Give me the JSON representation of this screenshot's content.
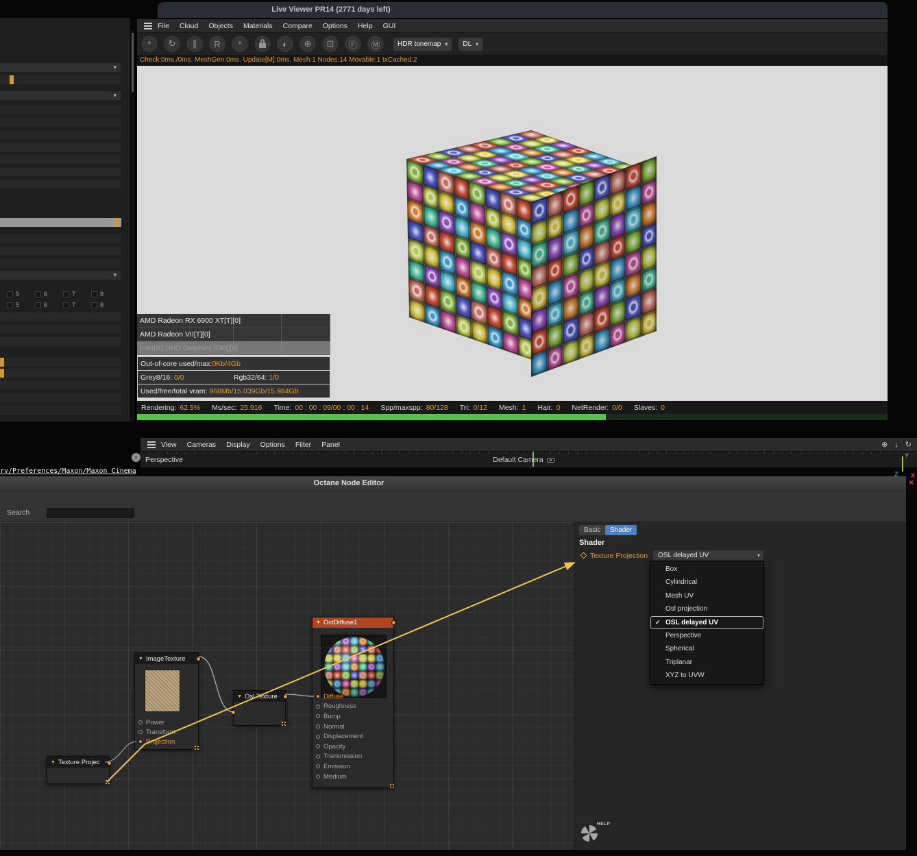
{
  "live_viewer": {
    "title": "Live Viewer PR14 (2771 days left)",
    "menu": [
      "File",
      "Cloud",
      "Objects",
      "Materials",
      "Compare",
      "Options",
      "Help",
      "GUI"
    ],
    "toolbar": {
      "icons": [
        {
          "name": "denoise-icon",
          "glyph": "*"
        },
        {
          "name": "restart-render-icon",
          "glyph": "↻"
        },
        {
          "name": "pause-render-icon",
          "glyph": "∥"
        },
        {
          "name": "region-render-icon",
          "glyph": "R"
        },
        {
          "name": "render-settings-icon",
          "glyph": "*"
        },
        {
          "name": "lock-resolution-icon",
          "glyph": ""
        },
        {
          "name": "clay-mode-icon",
          "glyph": "◐"
        },
        {
          "name": "render-region-add-icon",
          "glyph": "⊕"
        },
        {
          "name": "picking-mode-icon",
          "glyph": "⊡"
        },
        {
          "name": "focus-picker-icon",
          "glyph": "Ⓕ"
        },
        {
          "name": "material-picker-icon",
          "glyph": "Ⓜ"
        }
      ],
      "tonemap_dropdown": "HDR tonemap",
      "device_dropdown": "DL"
    },
    "stats_line": "Check:0ms./0ms. MeshGen:0ms. Update[M]:0ms. Mesh:1 Nodes:14 Movable:1 txCached:2",
    "gpu_table": {
      "rows": [
        {
          "name": "AMD Radeon RX 6900 XT[T][0]"
        },
        {
          "name": "AMD Radeon VII[T][0]"
        },
        {
          "name": "Intel(R) UHD Graphics 630[][0]"
        }
      ],
      "out_of_core_label": "Out-of-core used/max:",
      "out_of_core_value": "0Kb/4Gb",
      "grey_label": "Grey8/16:",
      "grey_value": "0/0",
      "rgb_label": "Rgb32/64:",
      "rgb_value": "1/0",
      "vram_label": "Used/free/total vram:",
      "vram_value": "968Mb/15.039Gb/15.984Gb"
    },
    "render_status": [
      {
        "label": "Rendering:",
        "value": "62.5%"
      },
      {
        "label": "Ms/sec:",
        "value": "25.916"
      },
      {
        "label": "Time:",
        "value": "00 : 00 : 09/00 : 00 : 14"
      },
      {
        "label": "Spp/maxspp:",
        "value": "80/128"
      },
      {
        "label": "Tri:",
        "value": "0/12"
      },
      {
        "label": "Mesh:",
        "value": "1"
      },
      {
        "label": "Hair:",
        "value": "0"
      },
      {
        "label": "NetRender:",
        "value": "0/0"
      },
      {
        "label": "Slaves:",
        "value": "0"
      }
    ],
    "progress_percent": 62.5
  },
  "left_panel": {
    "checkbox_rows": [
      [
        "5",
        "6",
        "7",
        "8"
      ],
      [
        "5",
        "6",
        "7",
        "8"
      ]
    ]
  },
  "c4d_viewport": {
    "menu": [
      "View",
      "Cameras",
      "Display",
      "Options",
      "Filter",
      "Panel"
    ],
    "right_icons": [
      {
        "name": "pan-view-icon",
        "glyph": "⊕"
      },
      {
        "name": "minimize-view-icon",
        "glyph": "↓"
      },
      {
        "name": "rotate-view-icon",
        "glyph": "↻"
      }
    ],
    "close_glyph": "×",
    "view_label": "Perspective",
    "camera_label": "Default Camera",
    "path_text": "rv/Preferences/Maxon/Maxon Cinema",
    "axis": {
      "x": "X",
      "y": "Y",
      "z": "Z"
    }
  },
  "node_editor": {
    "title": "Octane Node Editor",
    "close_glyph": "×",
    "search_label": "Search",
    "search_value": "",
    "tabs": [
      {
        "label": "Basic",
        "active": false
      },
      {
        "label": "Shader",
        "active": true
      }
    ],
    "section_title": "Shader",
    "param": {
      "label": "Texture Projection",
      "value": "OSL delayed UV"
    },
    "dropdown_options": [
      {
        "label": "Box",
        "selected": false
      },
      {
        "label": "Cylindrical",
        "selected": false
      },
      {
        "label": "Mesh UV",
        "selected": false
      },
      {
        "label": "Osl projection",
        "selected": false
      },
      {
        "label": "OSL delayed UV",
        "selected": true
      },
      {
        "label": "Perspective",
        "selected": false
      },
      {
        "label": "Spherical",
        "selected": false
      },
      {
        "label": "Triplanar",
        "selected": false
      },
      {
        "label": "XYZ to UVW",
        "selected": false
      }
    ],
    "help_label": "HELP",
    "nodes": {
      "texture_projection": {
        "title": "Texture Projec"
      },
      "image_texture": {
        "title": "ImageTexture",
        "params": [
          {
            "label": "Power",
            "highlight": false
          },
          {
            "label": "Transform",
            "highlight": false
          },
          {
            "label": "Projection",
            "highlight": true
          }
        ]
      },
      "osl_texture": {
        "title": "Osl Texture"
      },
      "oct_diffuse": {
        "title": "OctDiffuse1",
        "params": [
          {
            "label": "Diffuse",
            "highlight": true
          },
          {
            "label": "Roughness",
            "highlight": false
          },
          {
            "label": "Bump",
            "highlight": false
          },
          {
            "label": "Normal",
            "highlight": false
          },
          {
            "label": "Displacement",
            "highlight": false
          },
          {
            "label": "Opacity",
            "highlight": false
          },
          {
            "label": "Transmission",
            "highlight": false
          },
          {
            "label": "Emission",
            "highlight": false
          },
          {
            "label": "Medium",
            "highlight": false
          }
        ]
      }
    }
  },
  "colors": {
    "accent_orange": "#e6992e",
    "arrow_yellow": "#eec84e",
    "progress_green": "#56c14b",
    "tab_active_blue": "#4c7fc4",
    "node_header_red": "#b3441f",
    "viewport_gray": "#dadada",
    "checker_palette": [
      "#d94f35",
      "#e88932",
      "#e3cf3d",
      "#8cc63f",
      "#45c8a0",
      "#42a8e0",
      "#5058d0",
      "#9a4fd0",
      "#d052a8",
      "#d97a6a",
      "#4fc8e0",
      "#c8d84a"
    ]
  }
}
